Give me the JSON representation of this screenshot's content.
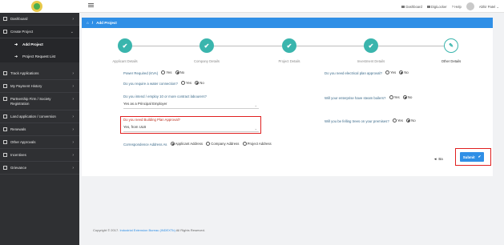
{
  "sidebar": {
    "items": [
      {
        "label": "Dashboard",
        "icon": "grid-icon"
      },
      {
        "label": "Create Project",
        "icon": "file-icon",
        "expanded": true
      },
      {
        "label": "Track Applications",
        "icon": "grid-icon"
      },
      {
        "label": "My Payment History",
        "icon": "card-icon"
      },
      {
        "label": "Partnership Firm / Society Registration",
        "icon": "file-icon"
      },
      {
        "label": "Land application / conversion",
        "icon": "file-icon"
      },
      {
        "label": "Renewals",
        "icon": "file-icon"
      },
      {
        "label": "Other Approvals",
        "icon": "file-icon"
      },
      {
        "label": "Incentives",
        "icon": "file-icon"
      },
      {
        "label": "Grievance",
        "icon": "file-icon"
      }
    ],
    "subitems": [
      {
        "label": "Add Project"
      },
      {
        "label": "Project Request List"
      }
    ]
  },
  "topbar": {
    "dashboard": "Dashboard",
    "digilocker": "DigiLocker",
    "help": "Help",
    "user": "Abhir Patel"
  },
  "breadcrumb": {
    "title": "Add Project"
  },
  "steps": [
    {
      "label": "Applicant Details",
      "done": true
    },
    {
      "label": "Company Details",
      "done": true
    },
    {
      "label": "Project Details",
      "done": true
    },
    {
      "label": "Investment Details",
      "done": true
    },
    {
      "label": "Other Details",
      "done": false
    }
  ],
  "form": {
    "power": {
      "question": "Power Required (KVA)",
      "yes": "Yes",
      "no": "No",
      "selected": "No"
    },
    "water": {
      "question": "Do you require a water connection?",
      "yes": "Yes",
      "no": "No",
      "selected": "No"
    },
    "laborers": {
      "question": "Do you intend / employ 10 or more contract labourers?",
      "value": "Yes as a Principal Employer"
    },
    "building": {
      "question": "Do you need Building Plan Approval?",
      "value": "Yes, from ULB"
    },
    "correspondence": {
      "question": "Correspondence Address As",
      "options": [
        "Applicant Address",
        "Company Address",
        "Project Address"
      ],
      "selected": "Applicant Address"
    },
    "electrical": {
      "question": "Do you need electrical plan approval?",
      "yes": "Yes",
      "no": "No",
      "selected": "No"
    },
    "boilers": {
      "question": "Will your enterprise have steam boilers?",
      "yes": "Yes",
      "no": "No",
      "selected": "No"
    },
    "trees": {
      "question": "Will you be felling trees on your premises?",
      "yes": "Yes",
      "no": "No",
      "selected": "No"
    }
  },
  "buttons": {
    "back": "Back",
    "submit": "Submit"
  },
  "footer": {
    "text": "Copyright © 2017.",
    "link": "Industrial Extension Bureau (iNDEXTb)",
    "rights": "All Rights Reserved."
  },
  "colors": {
    "accent": "#2f8fe6",
    "step": "#3ab5ad",
    "sidebar": "#2f3033",
    "highlight": "#e02020"
  }
}
